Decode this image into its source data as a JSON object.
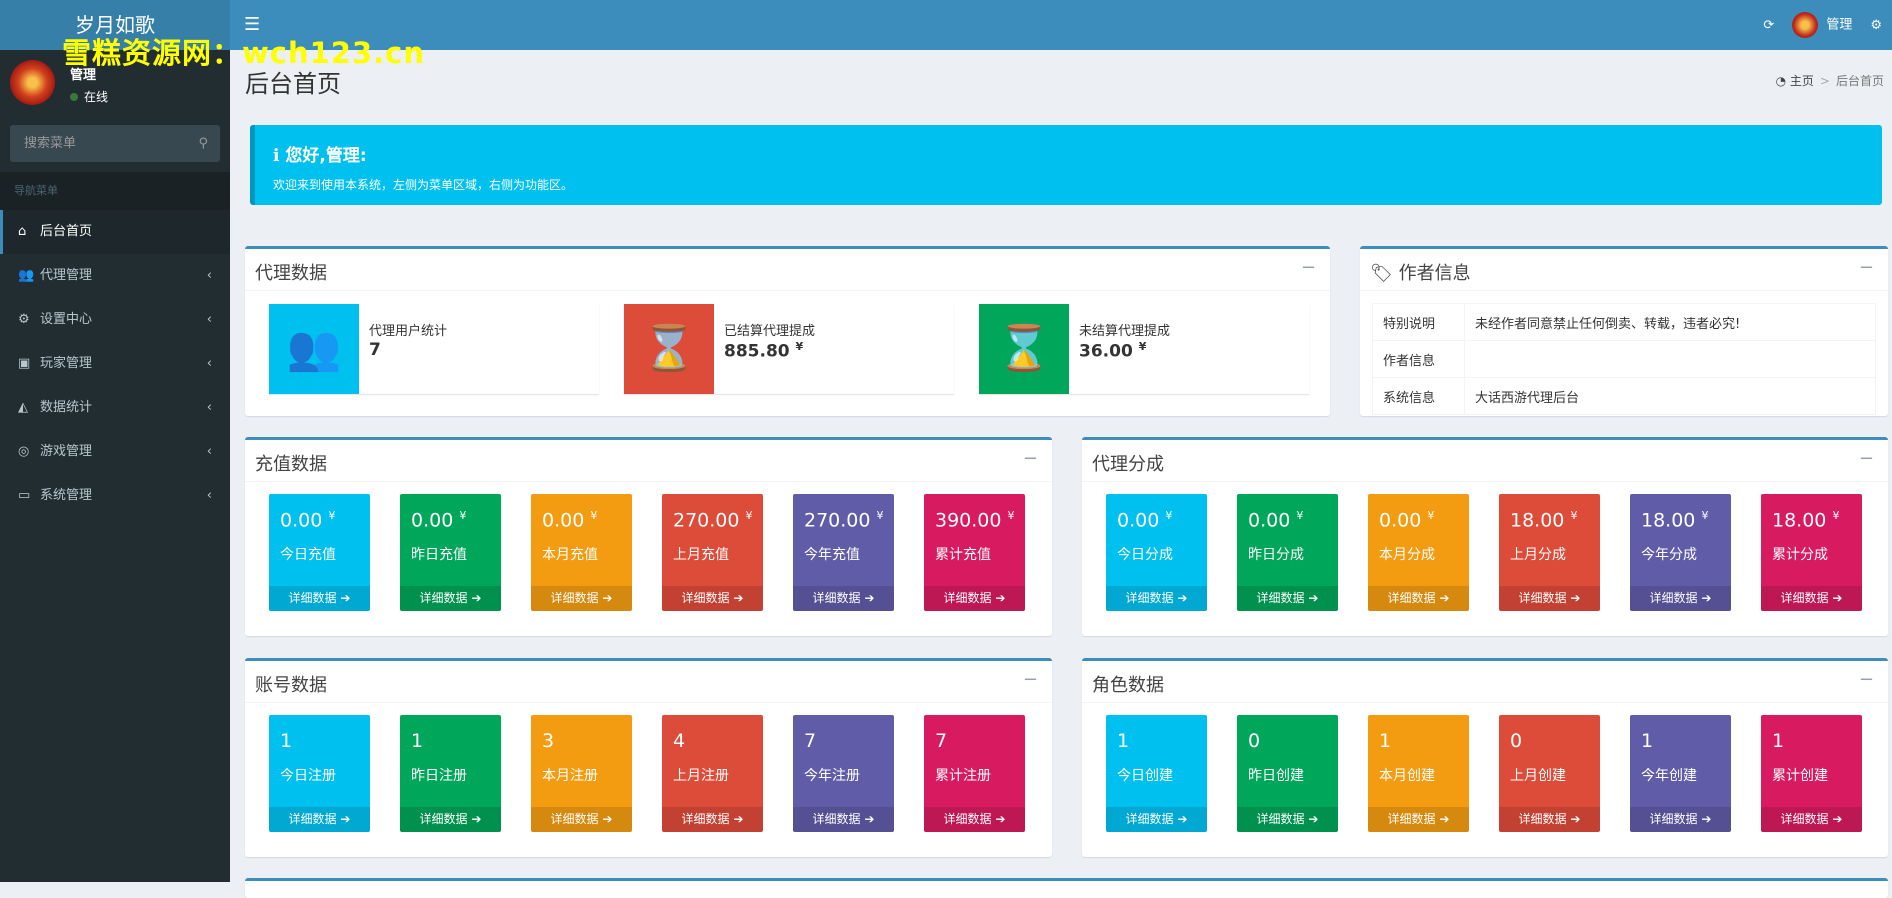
{
  "app": {
    "logo": "岁月如歌",
    "watermark": "雪糕资源网：wch123.cn"
  },
  "topbar": {
    "user": "管理"
  },
  "sidebar": {
    "user": "管理",
    "status": "在线",
    "search_placeholder": "搜索菜单",
    "nav_header": "导航菜单",
    "items": [
      {
        "label": "后台首页",
        "icon": "home-icon",
        "glyph": "⌂"
      },
      {
        "label": "代理管理",
        "icon": "users-icon",
        "glyph": "👥"
      },
      {
        "label": "设置中心",
        "icon": "gears-icon",
        "glyph": "⚙"
      },
      {
        "label": "玩家管理",
        "icon": "user-card-icon",
        "glyph": "▣"
      },
      {
        "label": "数据统计",
        "icon": "area-chart-icon",
        "glyph": "◭"
      },
      {
        "label": "游戏管理",
        "icon": "gamepad-icon",
        "glyph": "◎"
      },
      {
        "label": "系统管理",
        "icon": "desktop-icon",
        "glyph": "▭"
      }
    ]
  },
  "page": {
    "title": "后台首页",
    "breadcrumb": [
      "主页",
      "后台首页"
    ]
  },
  "callout": {
    "title": "您好,管理:",
    "text": "欢迎来到使用本系统，左侧为菜单区域，右侧为功能区。"
  },
  "agent": {
    "title": "代理数据",
    "items": [
      {
        "label": "代理用户统计",
        "value": "7",
        "color": "#00c0ef"
      },
      {
        "label": "已结算代理提成",
        "value": "885.80",
        "currency": "¥",
        "color": "#dd4b39"
      },
      {
        "label": "未结算代理提成",
        "value": "36.00",
        "currency": "¥",
        "color": "#00a65a"
      }
    ]
  },
  "author": {
    "title": "作者信息",
    "rows": [
      [
        "特别说明",
        "未经作者同意禁止任何倒卖、转载，违者必究!"
      ],
      [
        "作者信息",
        ""
      ],
      [
        "系统信息",
        "大话西游代理后台"
      ]
    ]
  },
  "colors": [
    "#00c0ef",
    "#00a65a",
    "#f39c12",
    "#dd4b39",
    "#605ca8",
    "#d81b60"
  ],
  "more": "详细数据",
  "recharge": {
    "title": "充值数据",
    "tiles": [
      {
        "v": "0.00",
        "c": "¥",
        "l": "今日充值"
      },
      {
        "v": "0.00",
        "c": "¥",
        "l": "昨日充值"
      },
      {
        "v": "0.00",
        "c": "¥",
        "l": "本月充值"
      },
      {
        "v": "270.00",
        "c": "¥",
        "l": "上月充值"
      },
      {
        "v": "270.00",
        "c": "¥",
        "l": "今年充值"
      },
      {
        "v": "390.00",
        "c": "¥",
        "l": "累计充值"
      }
    ]
  },
  "share": {
    "title": "代理分成",
    "tiles": [
      {
        "v": "0.00",
        "c": "¥",
        "l": "今日分成"
      },
      {
        "v": "0.00",
        "c": "¥",
        "l": "昨日分成"
      },
      {
        "v": "0.00",
        "c": "¥",
        "l": "本月分成"
      },
      {
        "v": "18.00",
        "c": "¥",
        "l": "上月分成"
      },
      {
        "v": "18.00",
        "c": "¥",
        "l": "今年分成"
      },
      {
        "v": "18.00",
        "c": "¥",
        "l": "累计分成"
      }
    ]
  },
  "account": {
    "title": "账号数据",
    "tiles": [
      {
        "v": "1",
        "l": "今日注册"
      },
      {
        "v": "1",
        "l": "昨日注册"
      },
      {
        "v": "3",
        "l": "本月注册"
      },
      {
        "v": "4",
        "l": "上月注册"
      },
      {
        "v": "7",
        "l": "今年注册"
      },
      {
        "v": "7",
        "l": "累计注册"
      }
    ]
  },
  "role": {
    "title": "角色数据",
    "tiles": [
      {
        "v": "1",
        "l": "今日创建"
      },
      {
        "v": "0",
        "l": "昨日创建"
      },
      {
        "v": "1",
        "l": "本月创建"
      },
      {
        "v": "0",
        "l": "上月创建"
      },
      {
        "v": "1",
        "l": "今年创建"
      },
      {
        "v": "1",
        "l": "累计创建"
      }
    ]
  }
}
